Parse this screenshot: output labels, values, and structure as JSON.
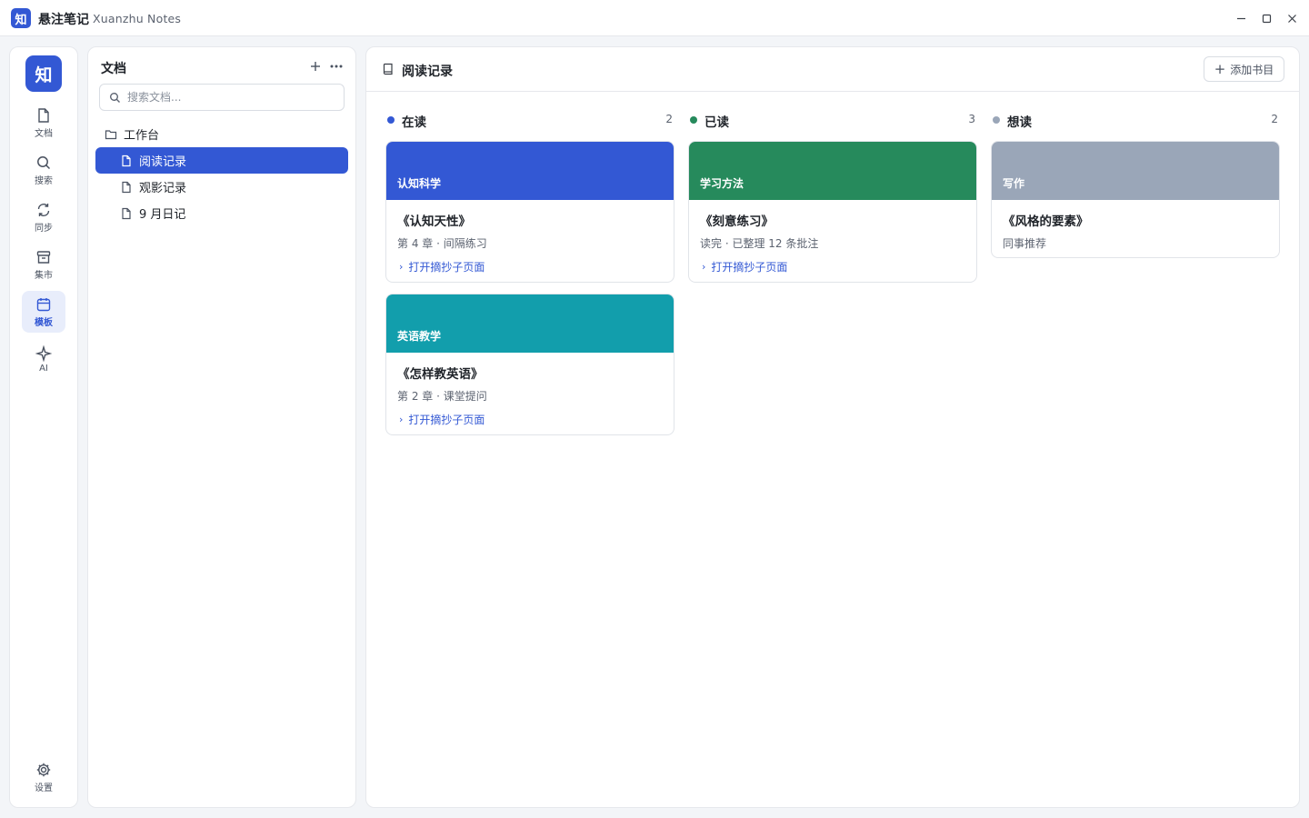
{
  "titlebar": {
    "logo_char": "知",
    "app_name": "悬注笔记",
    "app_subname": "Xuanzhu Notes"
  },
  "activity_bar": {
    "logo_char": "知",
    "items": [
      {
        "label": "文档",
        "icon": "document-icon"
      },
      {
        "label": "搜索",
        "icon": "search-icon"
      },
      {
        "label": "同步",
        "icon": "sync-icon"
      },
      {
        "label": "集市",
        "icon": "store-icon"
      },
      {
        "label": "模板",
        "icon": "calendar-icon",
        "active": true
      },
      {
        "label": "AI",
        "icon": "sparkle-icon"
      }
    ],
    "settings_label": "设置"
  },
  "sidebar": {
    "title": "文档",
    "search_placeholder": "搜索文档...",
    "folder": "工作台",
    "docs": [
      {
        "label": "阅读记录",
        "active": true
      },
      {
        "label": "观影记录"
      },
      {
        "label": "9 月日记"
      }
    ]
  },
  "main": {
    "title": "阅读记录",
    "add_button": "添加书目",
    "columns": [
      {
        "name": "在读",
        "count": "2",
        "color": "#3358d4",
        "cards": [
          {
            "tag": "认知科学",
            "cover_color": "#3358d4",
            "title": "《认知天性》",
            "meta": "第 4 章 · 间隔练习",
            "link": "打开摘抄子页面"
          },
          {
            "tag": "英语教学",
            "cover_color": "#129eac",
            "title": "《怎样教英语》",
            "meta": "第 2 章 · 课堂提问",
            "link": "打开摘抄子页面"
          }
        ]
      },
      {
        "name": "已读",
        "count": "3",
        "color": "#268a5c",
        "cards": [
          {
            "tag": "学习方法",
            "cover_color": "#268a5c",
            "title": "《刻意练习》",
            "meta": "读完 · 已整理 12 条批注",
            "link": "打开摘抄子页面"
          }
        ]
      },
      {
        "name": "想读",
        "count": "2",
        "color": "#9aa6b8",
        "cards": [
          {
            "tag": "写作",
            "cover_color": "#9aa6b8",
            "title": "《风格的要素》",
            "meta": "同事推荐"
          }
        ]
      }
    ]
  }
}
